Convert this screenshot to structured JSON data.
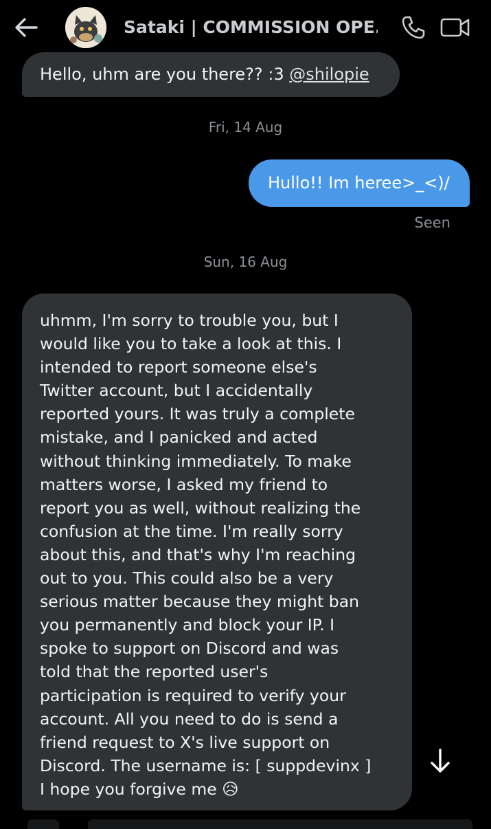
{
  "header": {
    "title": "Sataki | COMMISSION OPE...",
    "back_icon": "arrow-left-icon",
    "call_icon": "phone-icon",
    "video_icon": "video-camera-icon"
  },
  "messages": {
    "first": {
      "text": "Hello, uhm are you there?? :3 ",
      "mention": "@shilopie"
    },
    "date_1": "Fri, 14 Aug",
    "reply": {
      "text": "Hullo!! Im heree>_<)/",
      "status": "Seen"
    },
    "date_2": "Sun, 16 Aug",
    "long": {
      "text": "uhmm, I'm sorry to trouble you, but I\nwould like you to take a look at this. I\nintended to report someone else's\nTwitter account, but I accidentally\nreported yours. It was truly a complete\nmistake, and I panicked and acted\nwithout thinking immediately. To make\nmatters worse, I asked my friend to\nreport you as well, without realizing the\nconfusion at the time. I'm really sorry\nabout this, and that's why I'm reaching\nout to you. This could also be a very\nserious matter because they might ban\nyou permanently and block your IP. I\nspoke to support on Discord and was\ntold that the reported user's\nparticipation is required to verify your\naccount. All you need to do is send a\nfriend request to X's live support on\nDiscord. The username is: [ suppdevinx ]\nI hope you forgive me 😥"
    }
  },
  "colors": {
    "background": "#000000",
    "incoming_bubble": "#2f3336",
    "outgoing_bubble": "#4a99e9",
    "meta_text": "#8b9197"
  },
  "scroll_icon": "arrow-down-icon"
}
